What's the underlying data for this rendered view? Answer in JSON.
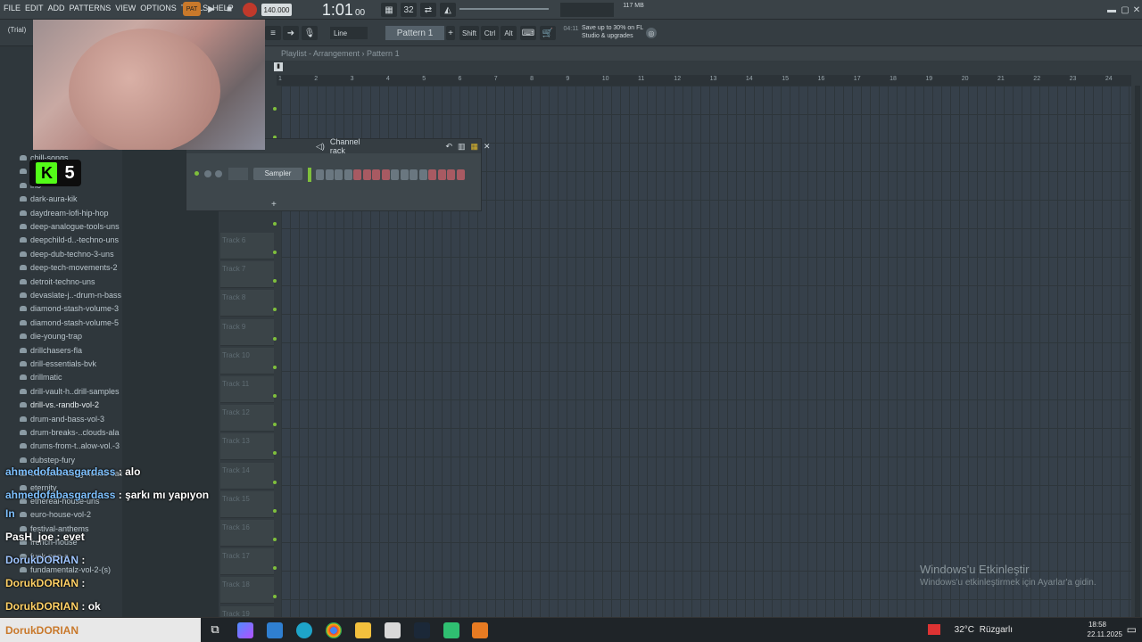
{
  "menu": [
    "FILE",
    "EDIT",
    "ADD",
    "PATTERNS",
    "VIEW",
    "OPTIONS",
    "TOOLS",
    "HELP"
  ],
  "transport": {
    "tempo": "140.000",
    "time": "1:01",
    "time_ms": "00",
    "mem": "117 MB",
    "cpu": "0",
    "poly": "0"
  },
  "toolbar2": {
    "trial": "(Trial)",
    "snap": "Line",
    "pattern": "Pattern 1",
    "shift": "Shift",
    "ctrl": "Ctrl",
    "alt": "Alt",
    "promo_date": "04:11",
    "promo": "Save up to 30% on FL Studio & upgrades"
  },
  "browser": {
    "items": [
      "chill-songs",
      "d-bass-loc",
      "ino",
      "dark-aura-kik",
      "daydream-lofi-hip-hop",
      "deep-analogue-tools-uns",
      "deepchild-d..-techno-uns",
      "deep-dub-techno-3-uns",
      "deep-tech-movements-2",
      "detroit-techno-uns",
      "devaslate-j..-drum-n-bass",
      "diamond-stash-volume-3",
      "diamond-stash-volume-5",
      "die-young-trap",
      "drillchasers-fla",
      "drill-essentials-bvk",
      "drillmatic",
      "drill-vault-h..drill-samples",
      "drill-vs.-randb-vol-2",
      "drum-and-bass-vol-3",
      "drum-breaks-..clouds-ala",
      "drums-from-t..alow-vol.-3",
      "dubstep-fury",
      "elements-ou..g-house-cas",
      "eternity",
      "ethereal-house-uns",
      "euro-house-vol-2",
      "festival-anthems",
      "french-house",
      "funk-pop-a",
      "fundamentalz-vol-2-(s)"
    ],
    "selected": "drill-vs.-randb-vol-2"
  },
  "playlist": {
    "title": "Playlist - Arrangement",
    "pattern": "Pattern 1",
    "ruler": [
      "1",
      "2",
      "3",
      "4",
      "5",
      "6",
      "7",
      "8",
      "9",
      "10",
      "11",
      "12",
      "13",
      "14",
      "15",
      "16",
      "17",
      "18",
      "19",
      "20",
      "21",
      "22",
      "23",
      "24"
    ],
    "tracks": [
      "Track 6",
      "Track 7",
      "Track 8",
      "Track 9",
      "Track 10",
      "Track 11",
      "Track 12",
      "Track 13",
      "Track 14",
      "Track 15",
      "Track 16",
      "Track 17",
      "Track 18",
      "Track 19"
    ]
  },
  "channel_rack": {
    "title": "Channel rack",
    "channel": "Sampler"
  },
  "stream": {
    "badge_count": "5"
  },
  "chat": [
    {
      "user": "ahmedofabasgardass",
      "msg": "alo"
    },
    {
      "user": "ahmedofabasgardass",
      "msg": "şarkı mı yapıyon"
    },
    {
      "user": "In",
      "msg": ""
    },
    {
      "user": "PasH_joe",
      "msg": "evet"
    },
    {
      "user": "DorukDORIAN",
      "msg": ""
    },
    {
      "user": "DorukDORIAN",
      "msg": ""
    },
    {
      "user": "DorukDORIAN",
      "msg": "ok"
    }
  ],
  "taskbar_user": "DorukDORIAN",
  "watermark": {
    "title": "Windows'u Etkinleştir",
    "sub": "Windows'u etkinleştirmek için Ayarlar'a gidin."
  },
  "tray": {
    "weather": "32°C",
    "weather_text": "Rüzgarlı",
    "time": "18:58",
    "date": "22.11.2025"
  },
  "colors": {
    "accent": "#7fbf3c",
    "rack_step_red": "#a85a62"
  }
}
